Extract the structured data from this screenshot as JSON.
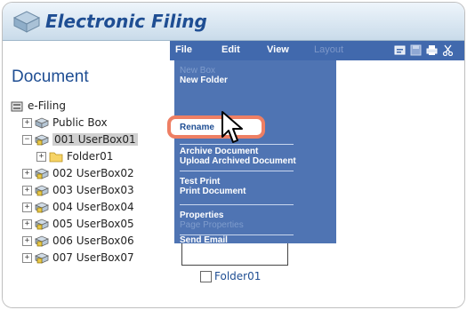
{
  "header": {
    "title": "Electronic Filing",
    "logo_icon": "box-logo-icon"
  },
  "left": {
    "title": "Document",
    "tree": [
      {
        "label": "e-Filing",
        "toggle": "",
        "icon": "efiling-icon"
      },
      {
        "label": "Public Box",
        "toggle": "+",
        "icon": "box-icon"
      },
      {
        "label": "001 UserBox01",
        "toggle": "−",
        "icon": "locked-box-icon",
        "selected": true
      },
      {
        "label": "Folder01",
        "toggle": "+",
        "icon": "folder-icon"
      },
      {
        "label": "002 UserBox02",
        "toggle": "+",
        "icon": "locked-box-icon"
      },
      {
        "label": "003 UserBox03",
        "toggle": "+",
        "icon": "locked-box-icon"
      },
      {
        "label": "004 UserBox04",
        "toggle": "+",
        "icon": "locked-box-icon"
      },
      {
        "label": "005 UserBox05",
        "toggle": "+",
        "icon": "locked-box-icon"
      },
      {
        "label": "006 UserBox06",
        "toggle": "+",
        "icon": "locked-box-icon"
      },
      {
        "label": "007 UserBox07",
        "toggle": "+",
        "icon": "locked-box-icon"
      }
    ]
  },
  "menubar": {
    "file": "File",
    "edit": "Edit",
    "view": "View",
    "layout": "Layout",
    "tools": [
      "clipboard-icon",
      "floppy-disk-icon",
      "printer-icon",
      "scissors-icon"
    ]
  },
  "file_menu": {
    "new_box": "New Box",
    "new_folder": "New Folder",
    "rename": "Rename",
    "archive": "Archive Document",
    "upload": "Upload Archived Document",
    "test_print": "Test Print",
    "print_doc": "Print Document",
    "properties": "Properties",
    "page_properties": "Page Properties",
    "send_email": "Send Email"
  },
  "content": {
    "folder_label": "Folder01"
  },
  "colors": {
    "brand": "#1f4e93",
    "menubar": "#4169ad",
    "dropdown": "#4f74b3",
    "highlight": "#ee7f64"
  }
}
